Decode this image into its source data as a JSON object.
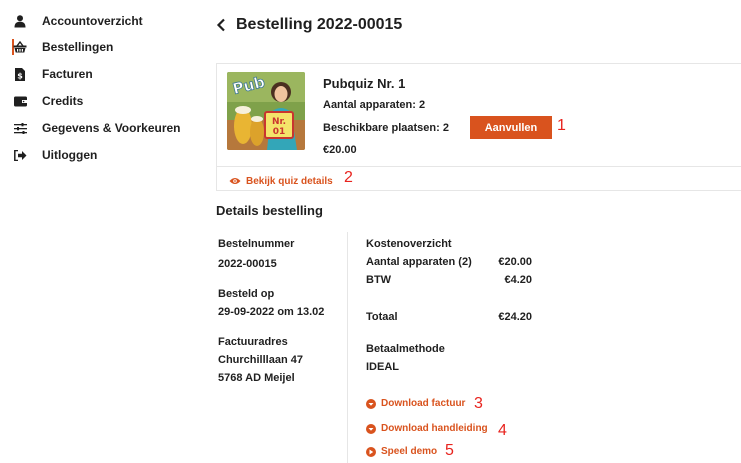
{
  "sidebar": {
    "items": [
      {
        "label": "Accountoverzicht",
        "icon": "person-icon"
      },
      {
        "label": "Bestellingen",
        "icon": "basket-icon"
      },
      {
        "label": "Facturen",
        "icon": "invoice-icon"
      },
      {
        "label": "Credits",
        "icon": "wallet-icon"
      },
      {
        "label": "Gegevens & Voorkeuren",
        "icon": "sliders-icon"
      },
      {
        "label": "Uitloggen",
        "icon": "logout-icon"
      }
    ]
  },
  "header": {
    "title": "Bestelling 2022-00015"
  },
  "product": {
    "title": "Pubquiz Nr. 1",
    "devices": "Aantal apparaten: 2",
    "seats": "Beschikbare plaatsen: 2",
    "price": "€20.00",
    "button_label": "Aanvullen",
    "thumb_text_top": "Pub",
    "thumb_text_badge_line1": "Nr.",
    "thumb_text_badge_line2": "01",
    "quiz_details_label": "Bekijk quiz details"
  },
  "details": {
    "section_title": "Details bestelling",
    "order_number_label": "Bestelnummer",
    "order_number": "2022-00015",
    "ordered_on_label": "Besteld op",
    "ordered_on": "29-09-2022 om 13.02",
    "invoice_address_label": "Factuuradres",
    "address_line1": "Churchilllaan 47",
    "address_line2": "5768 AD Meijel"
  },
  "costs": {
    "title": "Kostenoverzicht",
    "rows": [
      {
        "label": "Aantal apparaten (2)",
        "value": "€20.00"
      },
      {
        "label": "BTW",
        "value": "€4.20"
      }
    ],
    "total_label": "Totaal",
    "total_value": "€24.20",
    "payment_label": "Betaalmethode",
    "payment_value": "IDEAL"
  },
  "links": {
    "download_invoice": "Download factuur",
    "download_manual": "Download handleiding",
    "play_demo": "Speel demo"
  },
  "annotations": [
    "1",
    "2",
    "3",
    "4",
    "5"
  ],
  "colors": {
    "accent": "#d9531e",
    "annotation": "#e8231e",
    "text": "#1f1f1f",
    "border": "#e6e6e6"
  }
}
